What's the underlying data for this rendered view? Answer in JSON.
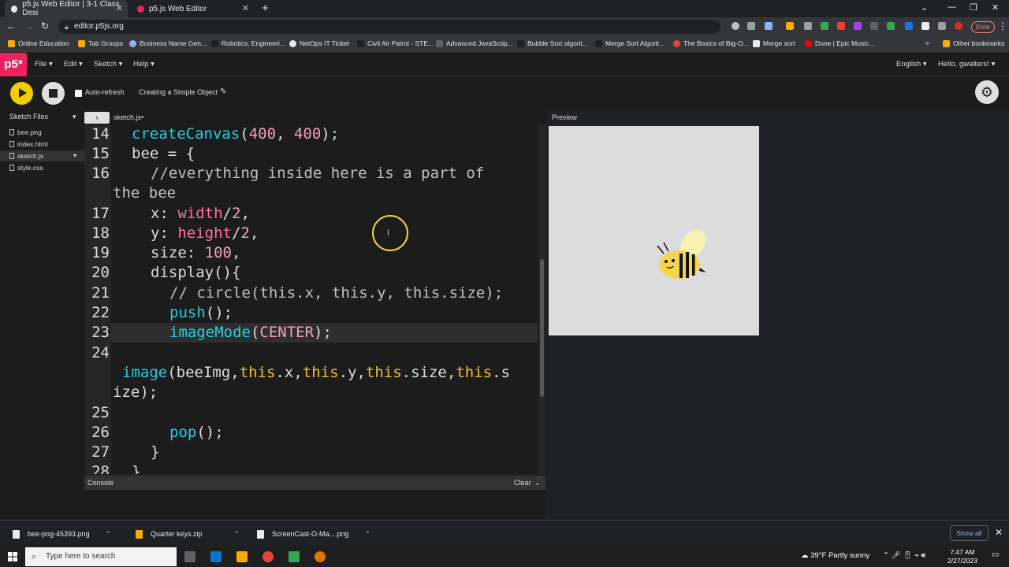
{
  "browser": {
    "tabs": [
      {
        "title": "p5.js Web Editor | 3-1 Class Desi"
      },
      {
        "title": "p5.js Web Editor"
      }
    ],
    "new_tab": "+",
    "url": "editor.p5js.org",
    "error_label": "Error",
    "bookmarks": [
      "Online Education",
      "Tab Groups",
      "Business Name Gen...",
      "Robotics, Engineeri...",
      "NetOps IT Ticket",
      "Civil Air Patrol - STE...",
      "Advanced JavaScrip...",
      "Bubble Sort algorit...",
      "Merge Sort Algorit...",
      "The Basics of Big-O...",
      "Merge sort",
      "Dune | Epic Music...",
      "Other bookmarks"
    ]
  },
  "p5": {
    "logo": "p5*",
    "menus": [
      "File",
      "Edit",
      "Sketch",
      "Help"
    ],
    "language": "English",
    "user": "Hello, gwalters!",
    "auto_refresh": "Auto-refresh",
    "sketch_name": "Creating a Simple Object",
    "sketch_files_label": "Sketch Files",
    "files": [
      "bee.png",
      "index.html",
      "sketch.js",
      "style.css"
    ],
    "active_file_tab": "sketch.js",
    "preview_label": "Preview",
    "console_label": "Console",
    "clear_label": "Clear"
  },
  "editor": {
    "line_numbers": [
      "14",
      "15",
      "16",
      "17",
      "18",
      "19",
      "20",
      "21",
      "22",
      "23",
      "24",
      "25",
      "26",
      "27",
      "28"
    ],
    "lines": {
      "l14a": "createCanvas",
      "l14b": "(",
      "l14c": "400",
      "l14d": ", ",
      "l14e": "400",
      "l14f": ");",
      "l15a": "bee",
      "l15b": " = {",
      "l16a": "//everything inside here is a part of",
      "l16b": "the bee",
      "l17a": "x: ",
      "l17b": "width",
      "l17c": "/",
      "l17d": "2",
      "l17e": ",",
      "l18a": "y: ",
      "l18b": "height",
      "l18c": "/",
      "l18d": "2",
      "l18e": ",",
      "l19a": "size: ",
      "l19b": "100",
      "l19c": ",",
      "l20a": "display(){",
      "l21a": "// circle(this.x, this.y, this.size);",
      "l22a": "push",
      "l22b": "();",
      "l23a": "imageMode",
      "l23b": "(",
      "l23c": "CENTER",
      "l23d": ");",
      "l24a": "image",
      "l24b": "(beeImg,",
      "l24c": "this",
      "l24d": ".x,",
      "l24e": "this",
      "l24f": ".y,",
      "l24g": "this",
      "l24h": ".size,",
      "l24i": "this",
      "l24j": ".s",
      "l24k": "ize);",
      "l26a": "pop",
      "l26b": "();",
      "l27a": "}",
      "l28a": "}"
    }
  },
  "downloads": {
    "items": [
      "bee-png-45393.png",
      "Quarter keys.zip",
      "ScreenCast-O-Ma....png"
    ],
    "show_all": "Show all"
  },
  "taskbar": {
    "search_placeholder": "Type here to search",
    "weather": "39°F  Partly sunny",
    "time": "7:47 AM",
    "date": "2/27/2023"
  },
  "colors": {
    "p5_pink": "#ed225d",
    "play_yellow": "#f0cc00",
    "keyword_cyan": "#21d0e0",
    "property_gold": "#f0c030"
  }
}
